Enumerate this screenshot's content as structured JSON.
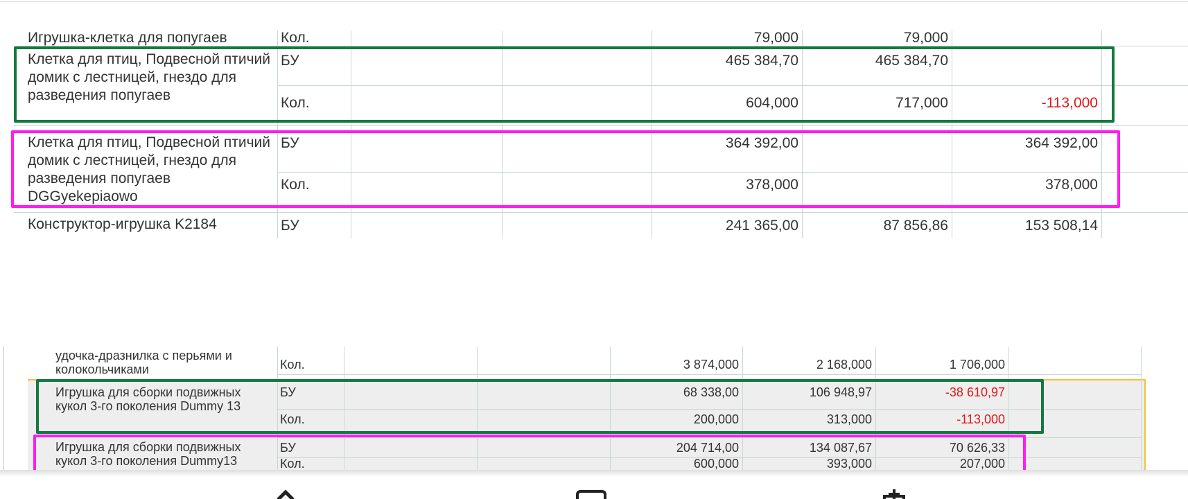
{
  "panel1": {
    "rows": [
      {
        "name": "Игрушка-клетка для попугаев",
        "type": "Кол.",
        "c1": "79,000",
        "c2": "79,000",
        "c3": ""
      },
      {
        "name": "Клетка для птиц, Подвесной птичий домик с лестницей, гнездо для разведения попугаев",
        "lines": [
          {
            "type": "БУ",
            "c1": "465 384,70",
            "c2": "465 384,70",
            "c3": ""
          },
          {
            "type": "Кол.",
            "c1": "604,000",
            "c2": "717,000",
            "c3": "-113,000"
          }
        ]
      },
      {
        "name": "Клетка для птиц, Подвесной птичий домик с лестницей, гнездо для разведения попугаев DGGyekepiaowo",
        "lines": [
          {
            "type": "БУ",
            "c1": "364 392,00",
            "c2": "",
            "c3": "364 392,00"
          },
          {
            "type": "Кол.",
            "c1": "378,000",
            "c2": "",
            "c3": "378,000"
          }
        ]
      },
      {
        "name": "Конструктор-игрушка K2184",
        "type": "БУ",
        "c1": "241 365,00",
        "c2": "87 856,86",
        "c3": "153 508,14"
      }
    ]
  },
  "panel2": {
    "rows": [
      {
        "name": "удочка-дразнилка с перьями и колокольчиками",
        "type": "Кол.",
        "c1": "3 874,000",
        "c2": "2 168,000",
        "c3": "1 706,000"
      },
      {
        "name": "Игрушка для сборки подвижных кукол 3-го поколения Dummy 13",
        "lines": [
          {
            "type": "БУ",
            "c1": "68 338,00",
            "c2": "106 948,97",
            "c3": "-38 610,97"
          },
          {
            "type": "Кол.",
            "c1": "200,000",
            "c2": "313,000",
            "c3": "-113,000"
          }
        ]
      },
      {
        "name": "Игрушка для сборки подвижных кукол 3-го поколения Dummy13",
        "lines": [
          {
            "type": "БУ",
            "c1": "204 714,00",
            "c2": "134 087,67",
            "c3": "70 626,33"
          },
          {
            "type": "Кол.",
            "c1": "600,000",
            "c2": "393,000",
            "c3": "207,000"
          }
        ]
      }
    ]
  },
  "colors": {
    "highlight_green": "#137a3e",
    "highlight_pink": "#ff1cf2",
    "negative": "#e01919",
    "selection_border": "#f5c13a"
  },
  "bottom_icons": [
    "back-arrow-icon",
    "home-icon",
    "share-icon"
  ]
}
